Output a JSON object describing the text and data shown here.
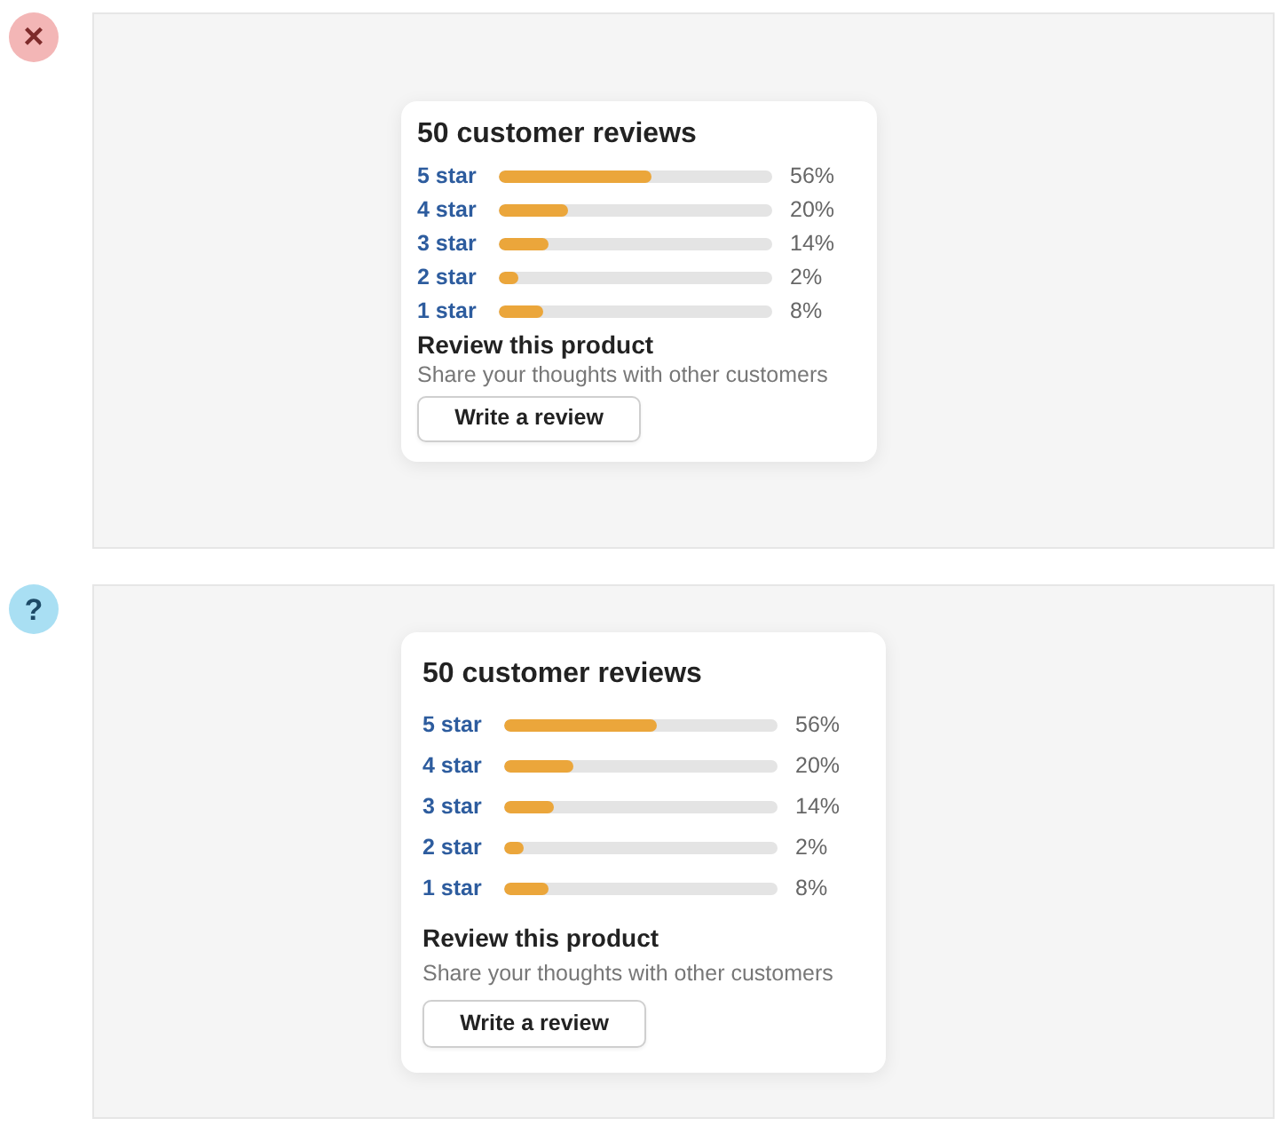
{
  "examples": [
    {
      "kind": "wrong",
      "badge": "×",
      "compact": true,
      "card": {
        "title": "50 customer reviews",
        "ratings": [
          {
            "label": "5 star",
            "level": 0.56,
            "percent": "56%"
          },
          {
            "label": "4 star",
            "level": 0.25,
            "percent": "20%"
          },
          {
            "label": "3 star",
            "level": 0.18,
            "percent": "14%"
          },
          {
            "label": "2 star",
            "level": 0.07,
            "percent": "2%"
          },
          {
            "label": "1 star",
            "level": 0.16,
            "percent": "8%"
          }
        ],
        "review_heading": "Review this product",
        "review_text": "Share your thoughts with other customers",
        "button": "Write a review"
      }
    },
    {
      "kind": "question",
      "badge": "?",
      "compact": false,
      "card": {
        "title": "50 customer reviews",
        "ratings": [
          {
            "label": "5 star",
            "level": 0.56,
            "percent": "56%"
          },
          {
            "label": "4 star",
            "level": 0.25,
            "percent": "20%"
          },
          {
            "label": "3 star",
            "level": 0.18,
            "percent": "14%"
          },
          {
            "label": "2 star",
            "level": 0.07,
            "percent": "2%"
          },
          {
            "label": "1 star",
            "level": 0.16,
            "percent": "8%"
          }
        ],
        "review_heading": "Review this product",
        "review_text": "Share your thoughts with other customers",
        "button": "Write a review"
      }
    }
  ]
}
